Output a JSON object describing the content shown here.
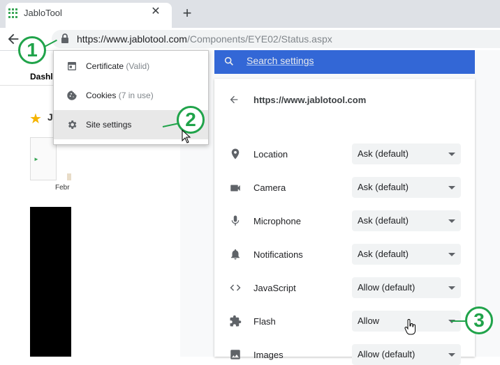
{
  "tab": {
    "title": "JabloTool",
    "close": "✕",
    "new_tab": "+"
  },
  "address": {
    "domain": "https://www.jablotool.com",
    "path": "/Components/EYE02/Status.aspx"
  },
  "popup": {
    "items": [
      {
        "label": "Certificate",
        "sub": "(Valid)",
        "icon": "certificate-icon"
      },
      {
        "label": "Cookies",
        "sub": "(7 in use)",
        "icon": "cookie-icon"
      },
      {
        "label": "Site settings",
        "sub": "",
        "icon": "gear-icon"
      }
    ]
  },
  "left_page": {
    "dashboard": "Dashl",
    "star_text": "J",
    "month": "Febr"
  },
  "settings": {
    "search_placeholder": "Search settings",
    "site_url": "https://www.jablotool.com",
    "permissions": [
      {
        "name": "Location",
        "value": "Ask (default)",
        "icon": "location-icon"
      },
      {
        "name": "Camera",
        "value": "Ask (default)",
        "icon": "camera-icon"
      },
      {
        "name": "Microphone",
        "value": "Ask (default)",
        "icon": "microphone-icon"
      },
      {
        "name": "Notifications",
        "value": "Ask (default)",
        "icon": "bell-icon"
      },
      {
        "name": "JavaScript",
        "value": "Allow (default)",
        "icon": "code-icon"
      },
      {
        "name": "Flash",
        "value": "Allow",
        "icon": "puzzle-icon"
      },
      {
        "name": "Images",
        "value": "Allow (default)",
        "icon": "image-icon"
      }
    ]
  },
  "callouts": {
    "one": "1",
    "two": "2",
    "three": "3"
  },
  "colors": {
    "callout_green": "#20a34a",
    "search_blue": "#3367d6",
    "star_gold": "#f5b400"
  }
}
